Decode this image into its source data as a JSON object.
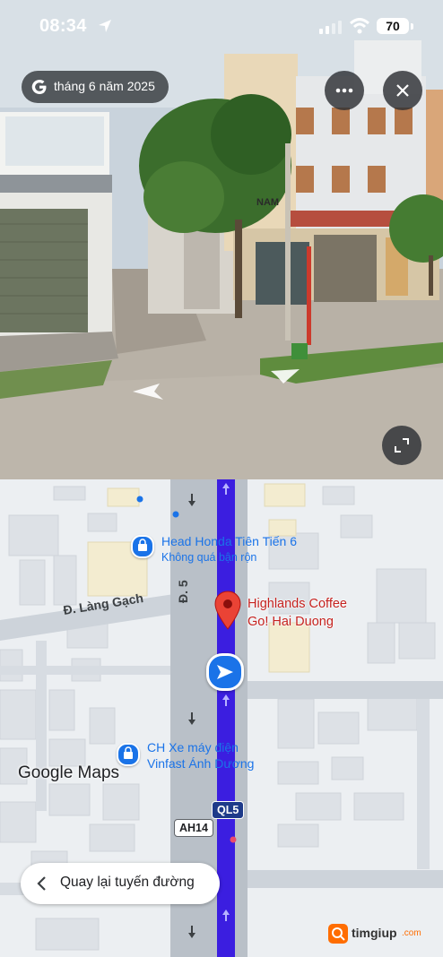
{
  "status_bar": {
    "time": "08:34",
    "battery": "70",
    "location_icon": "location-arrow-icon",
    "signal_icon": "cellular-signal-icon",
    "wifi_icon": "wifi-icon"
  },
  "street_view": {
    "date_label": "tháng 6 năm 2025",
    "brand_icon": "google-g-icon",
    "more_icon": "more-horizontal-icon",
    "close_icon": "close-icon",
    "expand_icon": "expand-icon",
    "shop_sign": "NAM"
  },
  "map": {
    "pois": [
      {
        "name": "Head Honda Tiên Tiến 6",
        "subtitle": "Không quá bận rộn"
      },
      {
        "name": "CH Xe máy điện",
        "subtitle": "Vinfast Ánh Dương"
      }
    ],
    "selected_place": {
      "line1": "Highlands Coffee",
      "line2": "Go! Hai Duong"
    },
    "road_labels": {
      "lang_gach": "Đ. Làng Gạch",
      "d5": "Đ. 5"
    },
    "shields": {
      "ql5": "QL5",
      "ah14": "AH14"
    },
    "logo": "Google Maps",
    "back_button_label": "Quay lại tuyến đường",
    "route_color": "#3b1ee0"
  },
  "watermark": {
    "brand": "timgiup",
    "tld": ".com"
  },
  "colors": {
    "accent": "#1a73e8",
    "pin": "#ea4335",
    "route": "#3b1ee0"
  }
}
